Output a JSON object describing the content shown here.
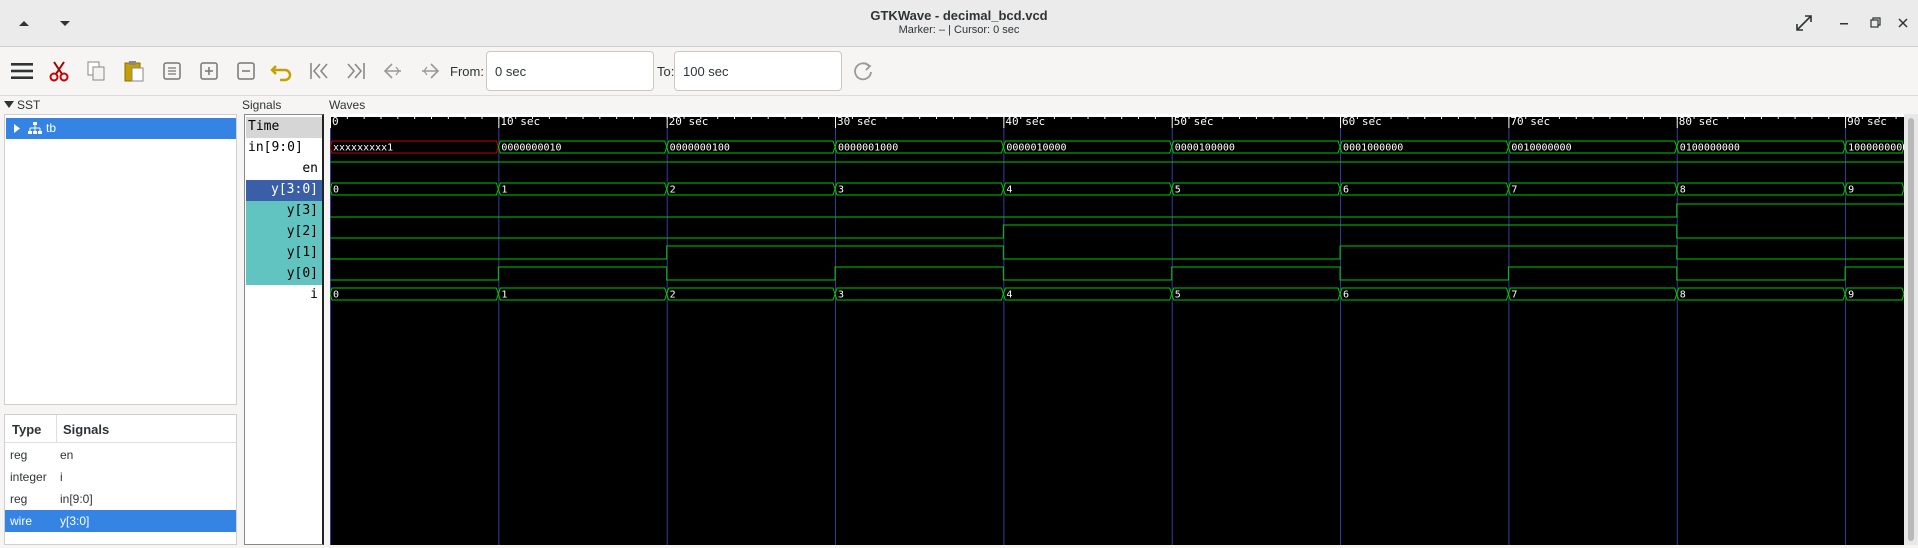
{
  "window": {
    "title": "GTKWave - decimal_bcd.vcd",
    "subtitle": "Marker: –  |  Cursor: 0 sec"
  },
  "toolbar": {
    "from_label": "From:",
    "from_value": "0 sec",
    "to_label": "To:",
    "to_value": "100 sec"
  },
  "sst": {
    "title": "SST",
    "tree": [
      {
        "label": "tb",
        "selected": true
      }
    ]
  },
  "signals_list": {
    "col_type": "Type",
    "col_signals": "Signals",
    "rows": [
      {
        "type": "reg",
        "name": "en",
        "selected": false
      },
      {
        "type": "integer",
        "name": "i",
        "selected": false
      },
      {
        "type": "reg",
        "name": "in[9:0]",
        "selected": false
      },
      {
        "type": "wire",
        "name": "y[3:0]",
        "selected": true
      }
    ]
  },
  "signals_pane": {
    "title": "Signals",
    "rows": [
      {
        "name": "Time",
        "style": "time"
      },
      {
        "name": "in[9:0]",
        "style": "normal"
      },
      {
        "name": "en",
        "style": "normal"
      },
      {
        "name": "y[3:0]",
        "style": "selected"
      },
      {
        "name": "y[3]",
        "style": "bit"
      },
      {
        "name": "y[2]",
        "style": "bit"
      },
      {
        "name": "y[1]",
        "style": "bit"
      },
      {
        "name": "y[0]",
        "style": "bit"
      },
      {
        "name": "i",
        "style": "normal"
      }
    ]
  },
  "waves": {
    "title": "Waves",
    "time_start": 0,
    "time_end": 93.5,
    "tick_step": 10,
    "tick_labels": [
      "0",
      "10 sec",
      "20 sec",
      "30 sec",
      "40 sec",
      "50 sec",
      "60 sec",
      "70 sec",
      "80 sec",
      "90 sec"
    ],
    "colors": {
      "background": "#000000",
      "trace": "#00c800",
      "grid": "#3a3aa0",
      "x_state": "#c80000",
      "text": "#ffffff"
    },
    "buses": [
      {
        "row": 1,
        "segments": [
          {
            "t0": 0,
            "t1": 10,
            "label": "xxxxxxxxx1",
            "x_state": true
          },
          {
            "t0": 10,
            "t1": 20,
            "label": "0000000010"
          },
          {
            "t0": 20,
            "t1": 30,
            "label": "0000000100"
          },
          {
            "t0": 30,
            "t1": 40,
            "label": "0000001000"
          },
          {
            "t0": 40,
            "t1": 50,
            "label": "0000010000"
          },
          {
            "t0": 50,
            "t1": 60,
            "label": "0000100000"
          },
          {
            "t0": 60,
            "t1": 70,
            "label": "0001000000"
          },
          {
            "t0": 70,
            "t1": 80,
            "label": "0010000000"
          },
          {
            "t0": 80,
            "t1": 90,
            "label": "0100000000"
          },
          {
            "t0": 90,
            "t1": 100,
            "label": "1000000000"
          }
        ]
      },
      {
        "row": 3,
        "segments": [
          {
            "t0": 0,
            "t1": 10,
            "label": "0"
          },
          {
            "t0": 10,
            "t1": 20,
            "label": "1"
          },
          {
            "t0": 20,
            "t1": 30,
            "label": "2"
          },
          {
            "t0": 30,
            "t1": 40,
            "label": "3"
          },
          {
            "t0": 40,
            "t1": 50,
            "label": "4"
          },
          {
            "t0": 50,
            "t1": 60,
            "label": "5"
          },
          {
            "t0": 60,
            "t1": 70,
            "label": "6"
          },
          {
            "t0": 70,
            "t1": 80,
            "label": "7"
          },
          {
            "t0": 80,
            "t1": 90,
            "label": "8"
          },
          {
            "t0": 90,
            "t1": 100,
            "label": "9"
          }
        ]
      },
      {
        "row": 8,
        "segments": [
          {
            "t0": 0,
            "t1": 10,
            "label": "0"
          },
          {
            "t0": 10,
            "t1": 20,
            "label": "1"
          },
          {
            "t0": 20,
            "t1": 30,
            "label": "2"
          },
          {
            "t0": 30,
            "t1": 40,
            "label": "3"
          },
          {
            "t0": 40,
            "t1": 50,
            "label": "4"
          },
          {
            "t0": 50,
            "t1": 60,
            "label": "5"
          },
          {
            "t0": 60,
            "t1": 70,
            "label": "6"
          },
          {
            "t0": 70,
            "t1": 80,
            "label": "7"
          },
          {
            "t0": 80,
            "t1": 90,
            "label": "8"
          },
          {
            "t0": 90,
            "t1": 100,
            "label": "9"
          }
        ]
      }
    ],
    "bits": [
      {
        "row": 2,
        "name": "en",
        "levels": [
          1,
          1,
          1,
          1,
          1,
          1,
          1,
          1,
          1,
          1
        ]
      },
      {
        "row": 4,
        "name": "y[3]",
        "levels": [
          0,
          0,
          0,
          0,
          0,
          0,
          0,
          0,
          1,
          1
        ]
      },
      {
        "row": 5,
        "name": "y[2]",
        "levels": [
          0,
          0,
          0,
          0,
          1,
          1,
          1,
          1,
          0,
          0
        ]
      },
      {
        "row": 6,
        "name": "y[1]",
        "levels": [
          0,
          0,
          1,
          1,
          0,
          0,
          1,
          1,
          0,
          0
        ]
      },
      {
        "row": 7,
        "name": "y[0]",
        "levels": [
          0,
          1,
          0,
          1,
          0,
          1,
          0,
          1,
          0,
          1
        ]
      }
    ]
  }
}
